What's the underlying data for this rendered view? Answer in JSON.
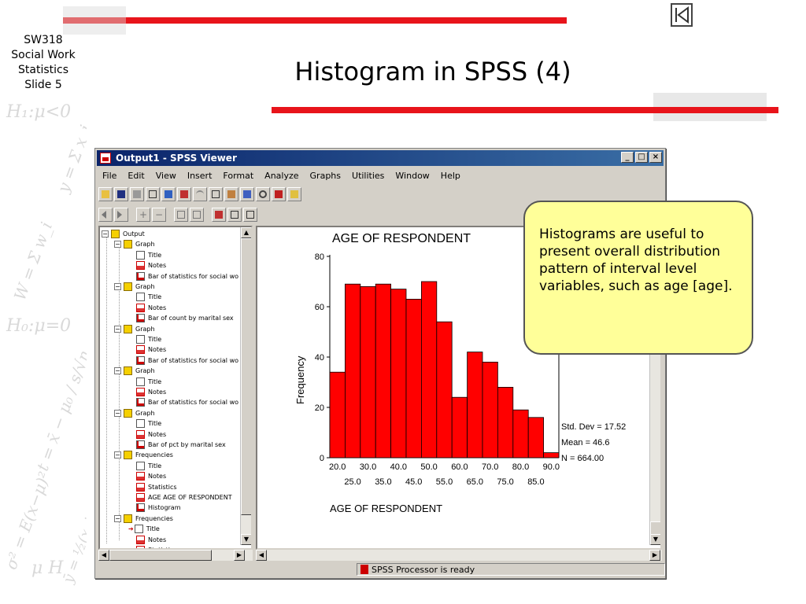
{
  "slide": {
    "course_lines": [
      "SW318",
      "Social Work",
      "Statistics",
      "Slide 5"
    ],
    "title": "Histogram in SPSS (4)",
    "math_decoration": [
      "H₁:μ<0",
      "y = Σ x_j",
      "W = Σ w_i",
      "H₀:μ=0",
      "t = x̄ − μ₀ / s/√n",
      "σ² = E(x−μ)²",
      "ȳ = ½(x_j + x_j+1)",
      "μ  H",
      "p"
    ],
    "callout": "Histograms are useful to present overall distribution pattern of interval level variables, such as age [age]."
  },
  "window": {
    "title": "Output1 - SPSS Viewer",
    "controls": [
      "_",
      "□",
      "×"
    ],
    "menu": [
      "File",
      "Edit",
      "View",
      "Insert",
      "Format",
      "Analyze",
      "Graphs",
      "Utilities",
      "Window",
      "Help"
    ],
    "status": "SPSS Processor  is ready"
  },
  "outline": {
    "items": [
      {
        "label": "Output",
        "level": 0,
        "icon": "book"
      },
      {
        "label": "Graph",
        "level": 1,
        "icon": "book"
      },
      {
        "label": "Title",
        "level": 2,
        "icon": "doc"
      },
      {
        "label": "Notes",
        "level": 2,
        "icon": "red"
      },
      {
        "label": "Bar of statistics for social wo",
        "level": 2,
        "icon": "chart"
      },
      {
        "label": "Graph",
        "level": 1,
        "icon": "book"
      },
      {
        "label": "Title",
        "level": 2,
        "icon": "doc"
      },
      {
        "label": "Notes",
        "level": 2,
        "icon": "red"
      },
      {
        "label": "Bar of count by marital sex",
        "level": 2,
        "icon": "chart"
      },
      {
        "label": "Graph",
        "level": 1,
        "icon": "book"
      },
      {
        "label": "Title",
        "level": 2,
        "icon": "doc"
      },
      {
        "label": "Notes",
        "level": 2,
        "icon": "red"
      },
      {
        "label": "Bar of statistics for social wo",
        "level": 2,
        "icon": "chart"
      },
      {
        "label": "Graph",
        "level": 1,
        "icon": "book"
      },
      {
        "label": "Title",
        "level": 2,
        "icon": "doc"
      },
      {
        "label": "Notes",
        "level": 2,
        "icon": "red"
      },
      {
        "label": "Bar of statistics for social wo",
        "level": 2,
        "icon": "chart"
      },
      {
        "label": "Graph",
        "level": 1,
        "icon": "book"
      },
      {
        "label": "Title",
        "level": 2,
        "icon": "doc"
      },
      {
        "label": "Notes",
        "level": 2,
        "icon": "red"
      },
      {
        "label": "Bar of pct by marital sex",
        "level": 2,
        "icon": "chart"
      },
      {
        "label": "Frequencies",
        "level": 1,
        "icon": "book"
      },
      {
        "label": "Title",
        "level": 2,
        "icon": "doc"
      },
      {
        "label": "Notes",
        "level": 2,
        "icon": "red"
      },
      {
        "label": "Statistics",
        "level": 2,
        "icon": "red"
      },
      {
        "label": "AGE  AGE OF RESPONDENT",
        "level": 2,
        "icon": "red"
      },
      {
        "label": "Histogram",
        "level": 2,
        "icon": "chart"
      },
      {
        "label": "Frequencies",
        "level": 1,
        "icon": "book"
      },
      {
        "label": "Title",
        "level": 2,
        "icon": "doc",
        "selected": true
      },
      {
        "label": "Notes",
        "level": 2,
        "icon": "red"
      },
      {
        "label": "Statistics",
        "level": 2,
        "icon": "red"
      }
    ]
  },
  "chart_data": {
    "type": "bar",
    "title": "AGE OF RESPONDENT",
    "xlabel": "AGE OF RESPONDENT",
    "ylabel": "Frequency",
    "ylim": [
      0,
      80
    ],
    "yticks": [
      0,
      20,
      40,
      60,
      80
    ],
    "xticks_top": [
      "20.0",
      "30.0",
      "40.0",
      "50.0",
      "60.0",
      "70.0",
      "80.0",
      "90.0"
    ],
    "xticks_bottom": [
      "25.0",
      "35.0",
      "45.0",
      "55.0",
      "65.0",
      "75.0",
      "85.0"
    ],
    "bin_start": 17.5,
    "bin_width": 5,
    "values": [
      34,
      69,
      68,
      69,
      67,
      63,
      70,
      54,
      24,
      42,
      38,
      28,
      19,
      16,
      2
    ],
    "color": "#ff0000",
    "stats": [
      "Std. Dev = 17.52",
      "Mean = 46.6",
      "N = 664.00"
    ]
  }
}
